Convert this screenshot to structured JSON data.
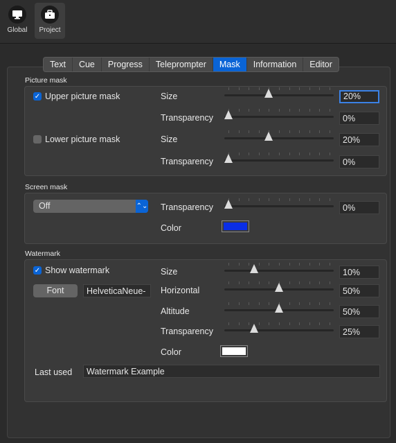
{
  "toolbar": {
    "items": [
      {
        "label": "Global",
        "icon": "monitor-icon"
      },
      {
        "label": "Project",
        "icon": "briefcase-icon"
      }
    ]
  },
  "tabs": [
    "Text",
    "Cue",
    "Progress",
    "Teleprompter",
    "Mask",
    "Information",
    "Editor"
  ],
  "active_tab": "Mask",
  "picture_mask": {
    "title": "Picture mask",
    "upper": {
      "label": "Upper picture mask",
      "checked": true,
      "size_label": "Size",
      "size": "20%",
      "size_level": 0.4,
      "transparency_label": "Transparency",
      "transparency": "0%",
      "transparency_level": 0.0
    },
    "lower": {
      "label": "Lower picture mask",
      "checked": false,
      "size_label": "Size",
      "size": "20%",
      "size_level": 0.4,
      "transparency_label": "Transparency",
      "transparency": "0%",
      "transparency_level": 0.0
    }
  },
  "screen_mask": {
    "title": "Screen mask",
    "mode": "Off",
    "transparency_label": "Transparency",
    "transparency": "0%",
    "transparency_level": 0.0,
    "color_label": "Color",
    "color": "#0a2ee6"
  },
  "watermark": {
    "title": "Watermark",
    "show_label": "Show watermark",
    "show_checked": true,
    "font_button": "Font",
    "font_name": "HelveticaNeue-",
    "size_label": "Size",
    "size": "10%",
    "size_level": 0.25,
    "horizontal_label": "Horizontal",
    "horizontal": "50%",
    "horizontal_level": 0.5,
    "altitude_label": "Altitude",
    "altitude": "50%",
    "altitude_level": 0.5,
    "transparency_label": "Transparency",
    "transparency": "25%",
    "transparency_level": 0.25,
    "color_label": "Color",
    "color": "#ffffff",
    "last_used_label": "Last used",
    "last_used_value": "Watermark Example"
  },
  "colors": {
    "accent": "#0a64d6"
  }
}
